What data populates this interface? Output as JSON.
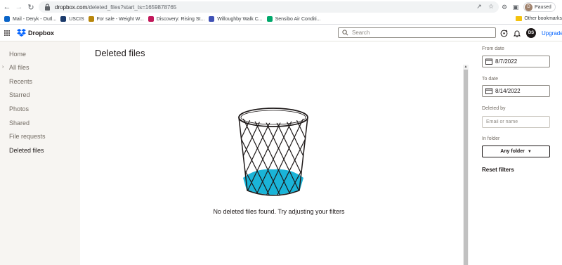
{
  "browser": {
    "url_host": "dropbox.com",
    "url_path": "/deleted_files?start_ts=1659878765",
    "profile_initial": "D",
    "profile_status": "Paused",
    "bookmarks": [
      {
        "label": "Mail - Deryk - Outl...",
        "color": "#0a64c8"
      },
      {
        "label": "USCIS",
        "color": "#1b3a6b"
      },
      {
        "label": "For sale - Weight W...",
        "color": "#b8860b"
      },
      {
        "label": "Discovery: Rising St...",
        "color": "#c2185b"
      },
      {
        "label": "Willoughby Walk C...",
        "color": "#3f51b5"
      },
      {
        "label": "Sensibo Air Conditi...",
        "color": "#00a86b"
      }
    ],
    "other_bookmarks": "Other bookmarks"
  },
  "app": {
    "logo_text": "Dropbox",
    "search_placeholder": "Search",
    "avatar_initials": "DS",
    "upgrade_label": "Upgrade"
  },
  "sidebar": {
    "items": [
      {
        "label": "Home"
      },
      {
        "label": "All files"
      },
      {
        "label": "Recents"
      },
      {
        "label": "Starred"
      },
      {
        "label": "Photos"
      },
      {
        "label": "Shared"
      },
      {
        "label": "File requests"
      },
      {
        "label": "Deleted files"
      }
    ]
  },
  "main": {
    "title": "Deleted files",
    "empty_message": "No deleted files found. Try adjusting your filters"
  },
  "filters": {
    "from_label": "From date",
    "from_value": "8/7/2022",
    "to_label": "To date",
    "to_value": "8/14/2022",
    "deleted_by_label": "Deleted by",
    "deleted_by_placeholder": "Email or name",
    "in_folder_label": "In folder",
    "folder_button": "Any folder",
    "reset_label": "Reset filters"
  },
  "colors": {
    "accent": "#0061fe",
    "trash_fill": "#1ab4d8",
    "sidebar_bg": "#f7f5f2"
  }
}
